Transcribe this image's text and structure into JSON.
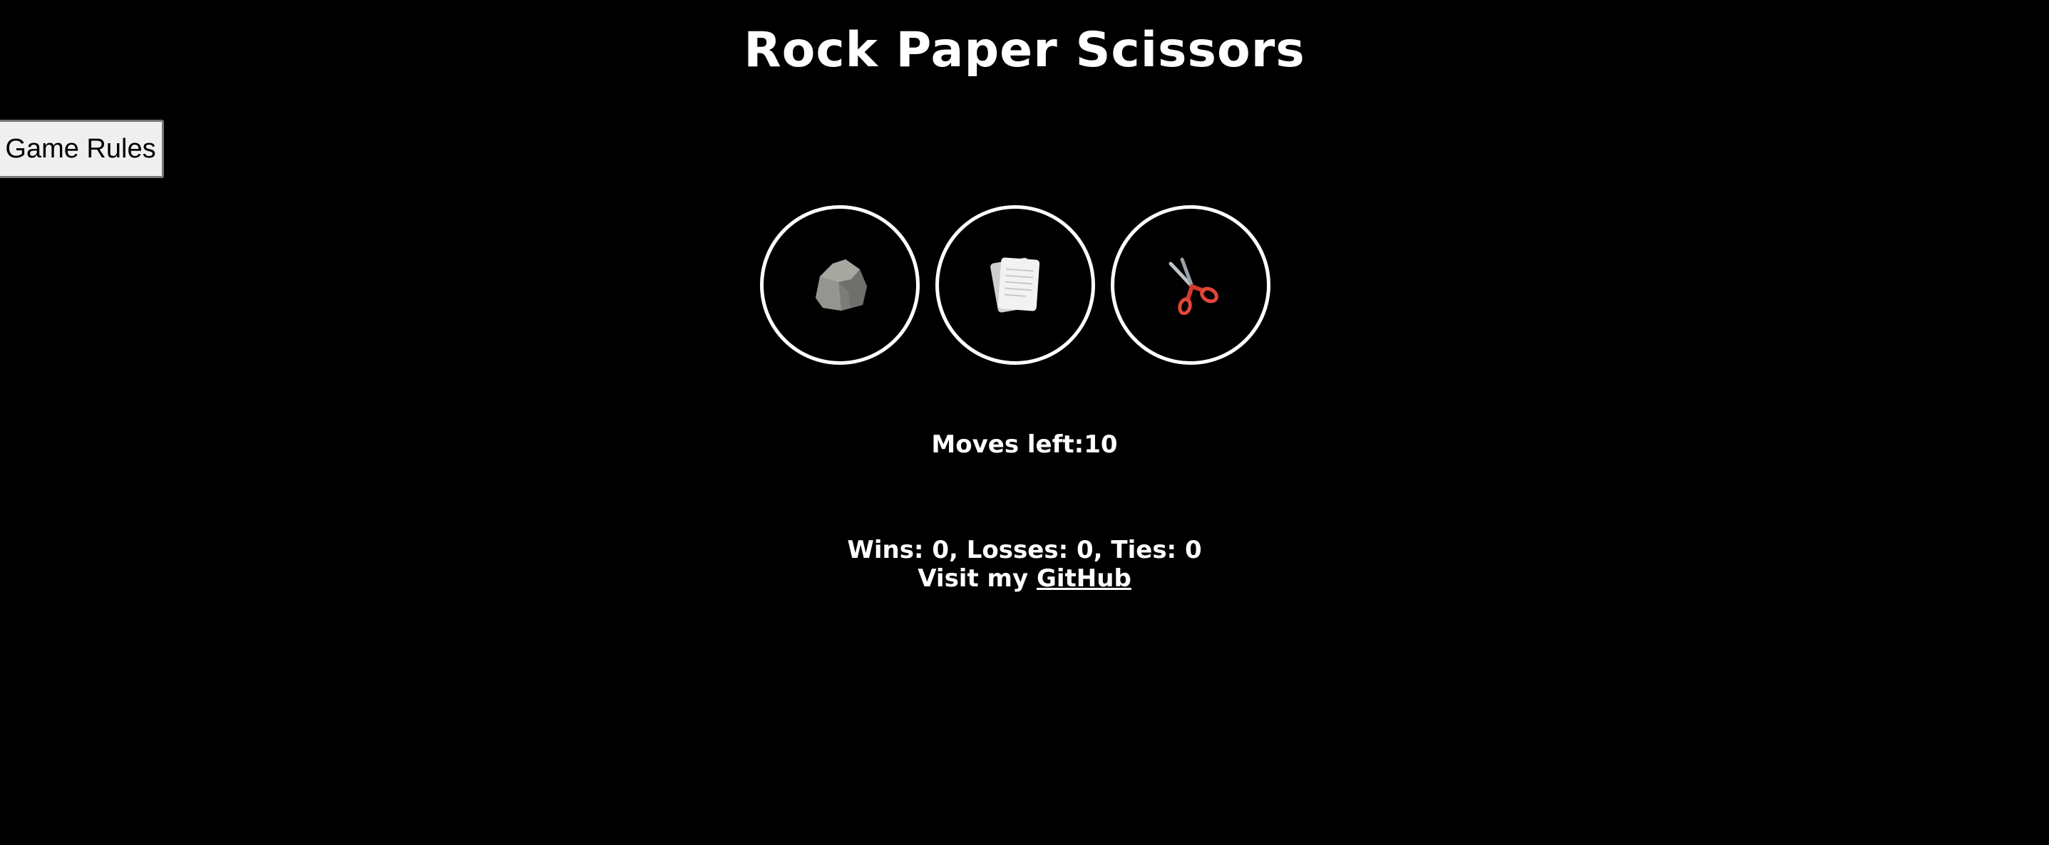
{
  "header": {
    "title": "Rock Paper Scissors"
  },
  "rules_button": {
    "label": "Game Rules"
  },
  "choices": [
    {
      "name": "rock",
      "icon": "rock-icon"
    },
    {
      "name": "paper",
      "icon": "paper-icon"
    },
    {
      "name": "scissors",
      "icon": "scissors-icon"
    }
  ],
  "status": {
    "moves_left": "Moves left:10"
  },
  "score": {
    "text": "Wins: 0, Losses: 0, Ties: 0"
  },
  "footer": {
    "visit_prefix": "Visit my ",
    "link_text": "GitHub"
  },
  "colors": {
    "background": "#000000",
    "text": "#ffffff",
    "circle_border": "#ffffff"
  }
}
